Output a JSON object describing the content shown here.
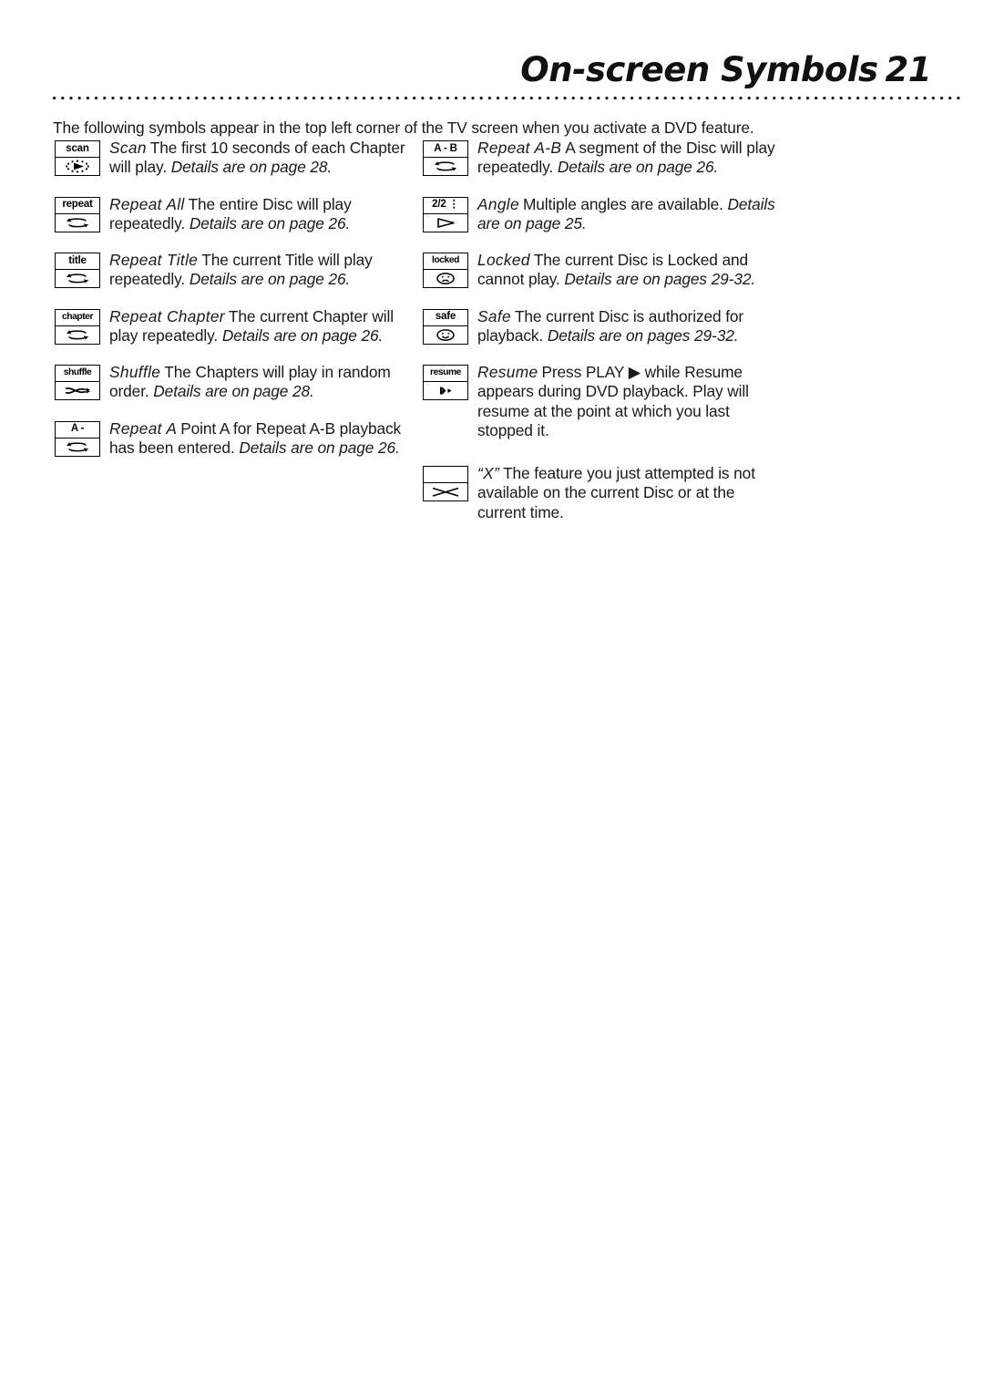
{
  "header": {
    "title": "On-screen Symbols",
    "page_number": "21"
  },
  "intro": "The following symbols appear in the top left corner of the TV screen when you activate a DVD feature.",
  "left_column": [
    {
      "icon_label": "scan",
      "icon_glyph": "scan-dotted-play-icon",
      "term": "Scan",
      "description": "The first 10 seconds of each Chapter will play.",
      "reference": "Details are on page 28."
    },
    {
      "icon_label": "repeat",
      "icon_glyph": "repeat-loop-icon",
      "term": "Repeat All",
      "description": "The entire Disc will play repeatedly.",
      "reference": "Details are on page 26."
    },
    {
      "icon_label": "title",
      "icon_glyph": "repeat-loop-icon",
      "term": "Repeat Title",
      "description": "The current Title will play repeatedly.",
      "reference": "Details are on page 26."
    },
    {
      "icon_label": "chapter",
      "icon_glyph": "repeat-loop-icon",
      "term": "Repeat Chapter",
      "description": "The current Chapter will play repeatedly.",
      "reference": "Details are on page 26."
    },
    {
      "icon_label": "shuffle",
      "icon_glyph": "shuffle-crossed-arrows-icon",
      "term": "Shuffle",
      "description": "The Chapters will play in random order.",
      "reference": "Details are on page 28."
    },
    {
      "icon_label": "A -",
      "icon_glyph": "repeat-loop-icon",
      "term": "Repeat A",
      "description": "Point A for Repeat A-B playback has been entered.",
      "reference": "Details are on page 26."
    }
  ],
  "right_column": [
    {
      "icon_label": "A - B",
      "icon_glyph": "repeat-loop-icon",
      "term": "Repeat A-B",
      "description": "A segment of the Disc will play repeatedly.",
      "reference": "Details are on page 26."
    },
    {
      "icon_label": "2/2 ⋮",
      "icon_glyph": "angle-outline-triangle-icon",
      "term": "Angle",
      "description": "Multiple angles are available.",
      "reference": "Details are on page 25."
    },
    {
      "icon_label": "locked",
      "icon_glyph": "sad-face-icon",
      "term": "Locked",
      "description": "The current Disc is Locked and cannot play.",
      "reference": "Details are on pages 29-32."
    },
    {
      "icon_label": "safe",
      "icon_glyph": "smiley-face-icon",
      "term": "Safe",
      "description": "The current Disc is authorized for playback.",
      "reference": "Details are on pages 29-32."
    },
    {
      "icon_label": "resume",
      "icon_glyph": "resume-bar-play-icon",
      "term": "Resume",
      "description": "Press PLAY ▶ while Resume appears during DVD playback. Play will resume at the point at which you last stopped it.",
      "reference": ""
    },
    {
      "icon_label": "",
      "icon_glyph": "x-cross-icon",
      "term": "“X”",
      "description": "The feature you just attempted is not available on the current Disc or at the current time.",
      "reference": ""
    }
  ],
  "colors": {
    "ink": "#1a1a1a",
    "paper": "#ffffff"
  }
}
